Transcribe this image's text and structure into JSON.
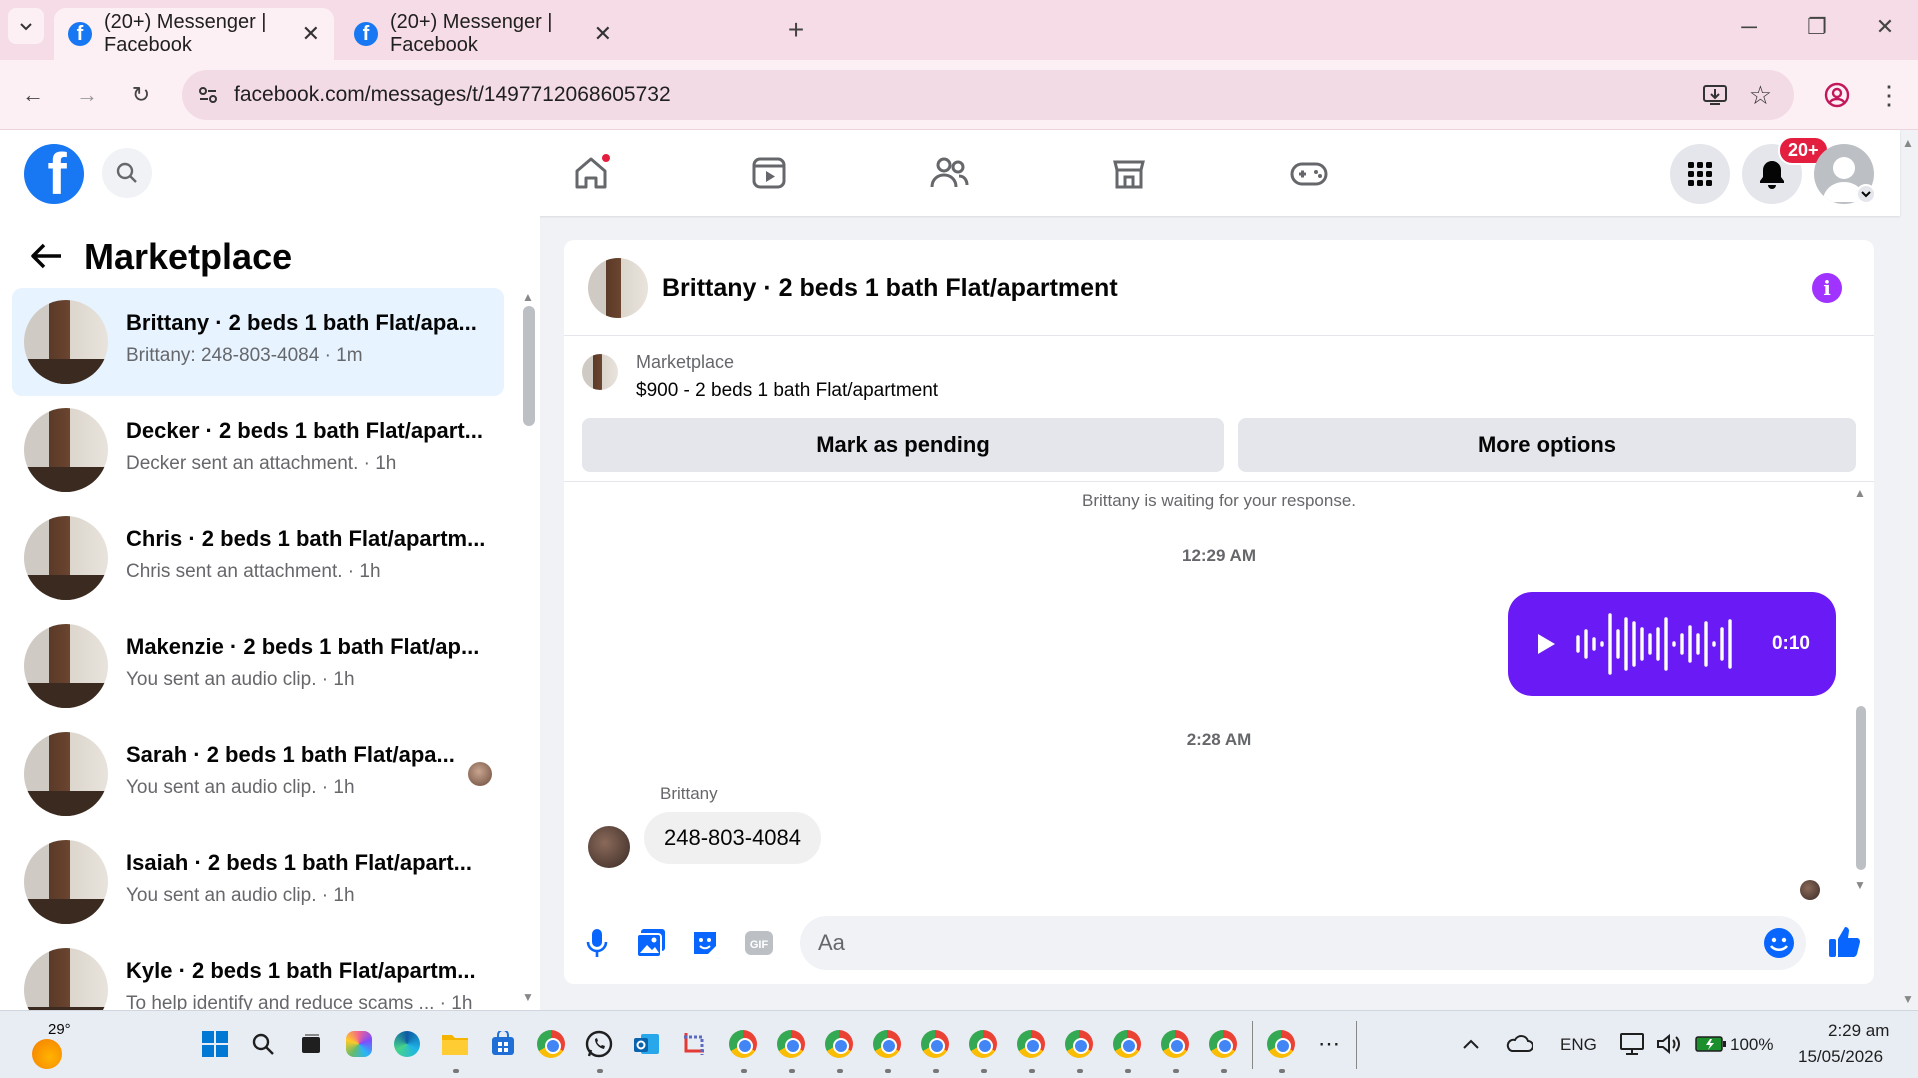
{
  "browser": {
    "tabs": [
      {
        "title": "(20+) Messenger | Facebook",
        "active": true
      },
      {
        "title": "(20+) Messenger | Facebook",
        "active": false
      }
    ],
    "url": "facebook.com/messages/t/1497712068605732"
  },
  "header": {
    "notification_badge": "20+"
  },
  "sidebar": {
    "title": "Marketplace",
    "conversations": [
      {
        "name": "Brittany · 2 beds 1 bath Flat/apa...",
        "preview": "Brittany: 248-803-4084 · 1m",
        "active": true
      },
      {
        "name": "Decker · 2 beds 1 bath Flat/apart...",
        "preview": "Decker sent an attachment. · 1h",
        "active": false
      },
      {
        "name": "Chris · 2 beds 1 bath Flat/apartm...",
        "preview": "Chris sent an attachment. · 1h",
        "active": false
      },
      {
        "name": "Makenzie · 2 beds 1 bath Flat/ap...",
        "preview": "You sent an audio clip. · 1h",
        "active": false
      },
      {
        "name": "Sarah · 2 beds 1 bath Flat/apa...",
        "preview": "You sent an audio clip. · 1h",
        "active": false
      },
      {
        "name": "Isaiah · 2 beds 1 bath Flat/apart...",
        "preview": "You sent an audio clip. · 1h",
        "active": false
      },
      {
        "name": "Kyle · 2 beds 1 bath Flat/apartm...",
        "preview": "To help identify and reduce scams ... · 1h",
        "active": false
      }
    ]
  },
  "chat": {
    "title": "Brittany · 2 beds 1 bath Flat/apartment",
    "listing": {
      "label": "Marketplace",
      "price_title": "$900 - 2 beds 1 bath Flat/apartment",
      "mark_pending": "Mark as pending",
      "more_options": "More options"
    },
    "system_message": "Brittany is waiting for your response.",
    "timestamp_1": "12:29 AM",
    "audio_duration": "0:10",
    "timestamp_2": "2:28 AM",
    "sender": "Brittany",
    "message": "248-803-4084",
    "input_placeholder": "Aa"
  },
  "taskbar": {
    "weather": "29°",
    "language": "ENG",
    "battery": "100%",
    "time": "2:29 am",
    "date": "15/05/2026"
  },
  "colors": {
    "fb_blue": "#1877f2",
    "messenger_purple": "#6a1bf5",
    "active_conv": "#e7f3ff",
    "badge_red": "#e41e3f"
  }
}
